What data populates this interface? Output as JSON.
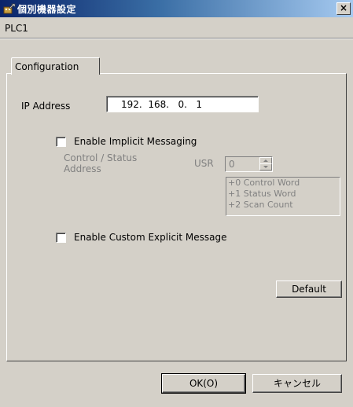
{
  "window": {
    "title": "個別機器設定",
    "close_label": "×",
    "app_icon": "device-settings-icon"
  },
  "device_name": "PLC1",
  "tabs": [
    {
      "label": "Configuration"
    }
  ],
  "config": {
    "ip_label": "IP Address",
    "ip_value": "192.  168.   0.   1",
    "implicit": {
      "label": "Enable Implicit Messaging",
      "checked": false,
      "control_status_line1": "Control / Status",
      "control_status_line2": "Address",
      "usr_label": "USR",
      "usr_value": "0",
      "words": [
        "+0 Control Word",
        "+1 Status Word",
        "+2 Scan Count"
      ]
    },
    "explicit": {
      "label": "Enable Custom Explicit Message",
      "checked": false
    },
    "default_button": "Default"
  },
  "footer": {
    "ok_label": "OK(O)",
    "cancel_label": "キャンセル"
  }
}
